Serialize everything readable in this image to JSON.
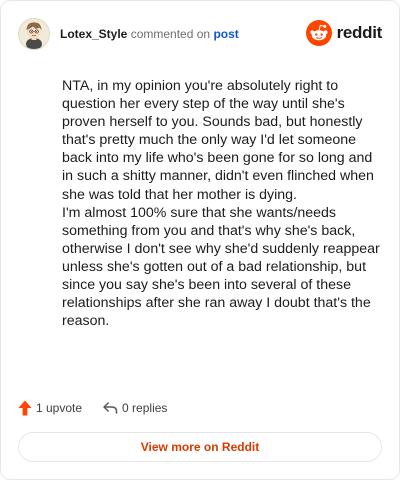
{
  "header": {
    "username": "Lotex_Style",
    "commented_text": "commented on",
    "post_link": "post",
    "brand": "reddit",
    "brand_color": "#ff4500"
  },
  "comment": {
    "paragraphs": [
      "NTA, in my opinion you're absolutely right to question her every step of the way until she's proven herself to you. Sounds bad, but honestly that's pretty much the only way I'd let someone back into my life who's been gone for so long and in such a shitty manner, didn't even flinched when she was told that her mother is dying.",
      "I'm almost 100% sure that she wants/needs something from you and that's why she's back, otherwise I don't see why she'd suddenly reappear unless she's gotten out of a bad relationship, but since you say she's been into several of these relationships after she ran away I doubt that's the reason."
    ]
  },
  "actions": {
    "upvote_label": "1 upvote",
    "replies_label": "0 replies",
    "upvote_icon": "upvote-arrow-icon",
    "reply_icon": "reply-arrow-icon"
  },
  "footer": {
    "view_more_label": "View more on Reddit",
    "accent_color": "#d93a00"
  }
}
